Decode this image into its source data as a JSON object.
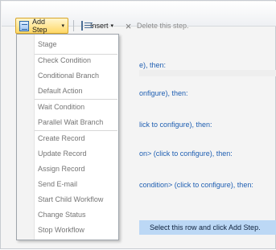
{
  "toolbar": {
    "add_step": "Add Step",
    "insert": "Insert",
    "delete": "Delete this step."
  },
  "workflow_rows": [
    "e), then:",
    "onfigure), then:",
    "lick to configure), then:",
    "on> (click to configure), then:",
    "condition> (click to configure), then:"
  ],
  "hint": "Select this row and click Add Step.",
  "menu": {
    "items": [
      "Stage",
      "Check Condition",
      "Conditional Branch",
      "Default Action",
      "Wait Condition",
      "Parallel Wait Branch",
      "Create Record",
      "Update Record",
      "Assign Record",
      "Send E-mail",
      "Start Child Workflow",
      "Change Status",
      "Stop Workflow"
    ]
  }
}
